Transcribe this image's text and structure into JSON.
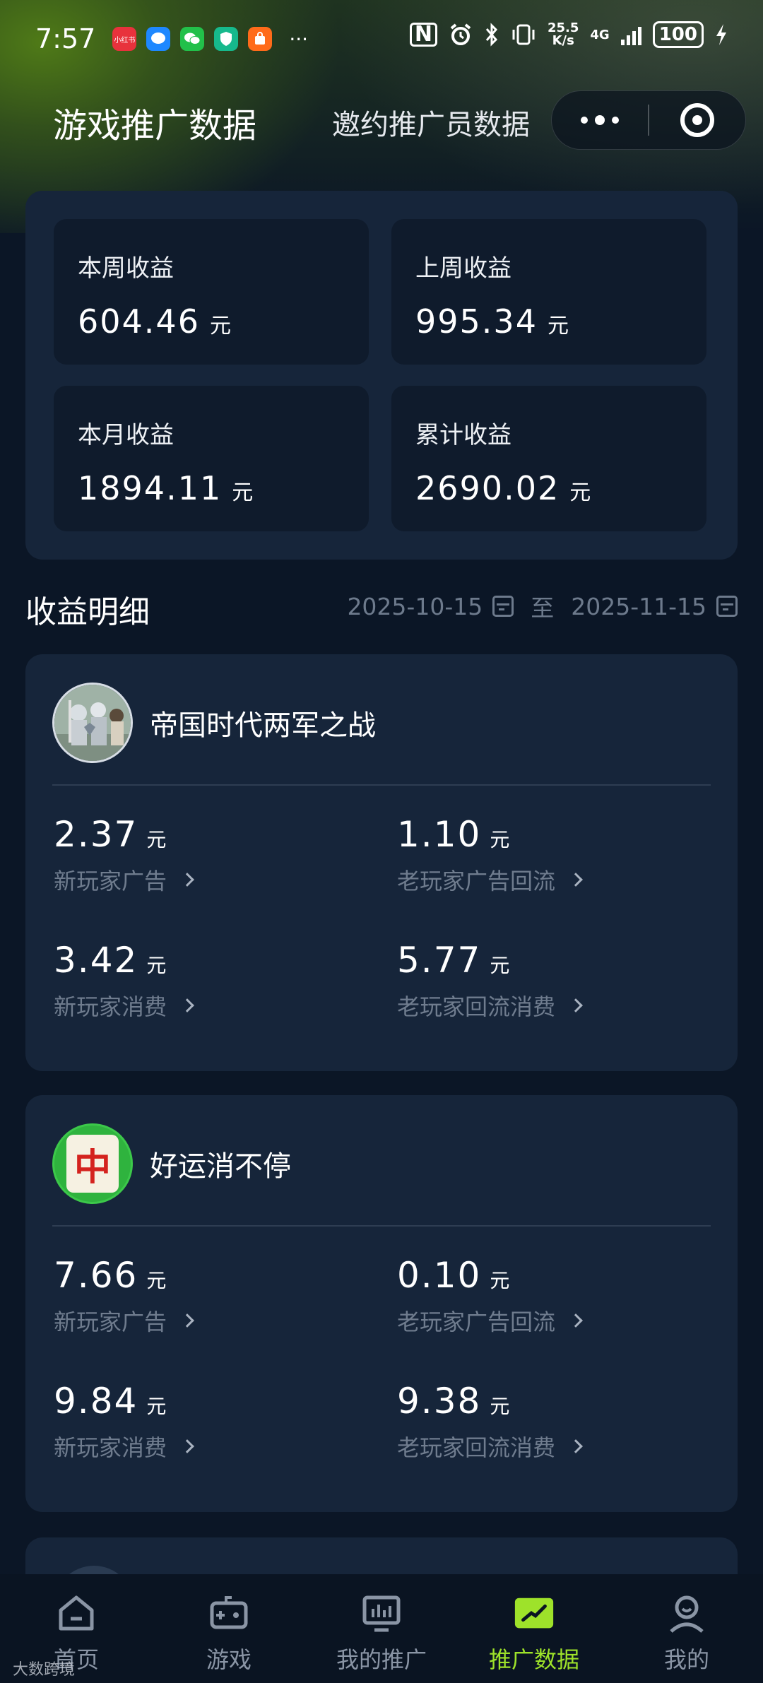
{
  "status_bar": {
    "time": "7:57",
    "app_badges": [
      "小红书",
      "",
      "",
      "",
      ""
    ],
    "more": "···",
    "nfc": "N",
    "speed_top": "25.5",
    "speed_bottom": "K/s",
    "network": "4G",
    "battery": "100"
  },
  "header": {
    "active_tab": "游戏推广数据",
    "inactive_tab": "邀约推广员数据"
  },
  "summary": {
    "unit": "元",
    "cards": [
      {
        "label": "本周收益",
        "value": "604.46"
      },
      {
        "label": "上周收益",
        "value": "995.34"
      },
      {
        "label": "本月收益",
        "value": "1894.11"
      },
      {
        "label": "累计收益",
        "value": "2690.02"
      }
    ]
  },
  "detail": {
    "title": "收益明细",
    "start_date": "2025-10-15",
    "to": "至",
    "end_date": "2025-11-15"
  },
  "games": [
    {
      "name": "帝国时代两军之战",
      "unit": "元",
      "metrics": [
        {
          "value": "2.37",
          "label": "新玩家广告"
        },
        {
          "value": "1.10",
          "label": "老玩家广告回流"
        },
        {
          "value": "3.42",
          "label": "新玩家消费"
        },
        {
          "value": "5.77",
          "label": "老玩家回流消费"
        }
      ]
    },
    {
      "name": "好运消不停",
      "unit": "元",
      "avatar_text": "中",
      "metrics": [
        {
          "value": "7.66",
          "label": "新玩家广告"
        },
        {
          "value": "0.10",
          "label": "老玩家广告回流"
        },
        {
          "value": "9.84",
          "label": "新玩家消费"
        },
        {
          "value": "9.38",
          "label": "老玩家回流消费"
        }
      ]
    }
  ],
  "bottom_nav": [
    {
      "label": "首页",
      "icon": "home-icon"
    },
    {
      "label": "游戏",
      "icon": "gamepad-icon"
    },
    {
      "label": "我的推广",
      "icon": "promotion-monitor-icon"
    },
    {
      "label": "推广数据",
      "icon": "trend-chart-icon",
      "active": true
    },
    {
      "label": "我的",
      "icon": "user-icon"
    }
  ],
  "watermark": "大数跨境",
  "colors": {
    "background": "#0b1626",
    "card": "#16253a",
    "inner_card": "#0f1b2c",
    "accent": "#9ee22a",
    "muted_text": "#6f7c8e"
  }
}
